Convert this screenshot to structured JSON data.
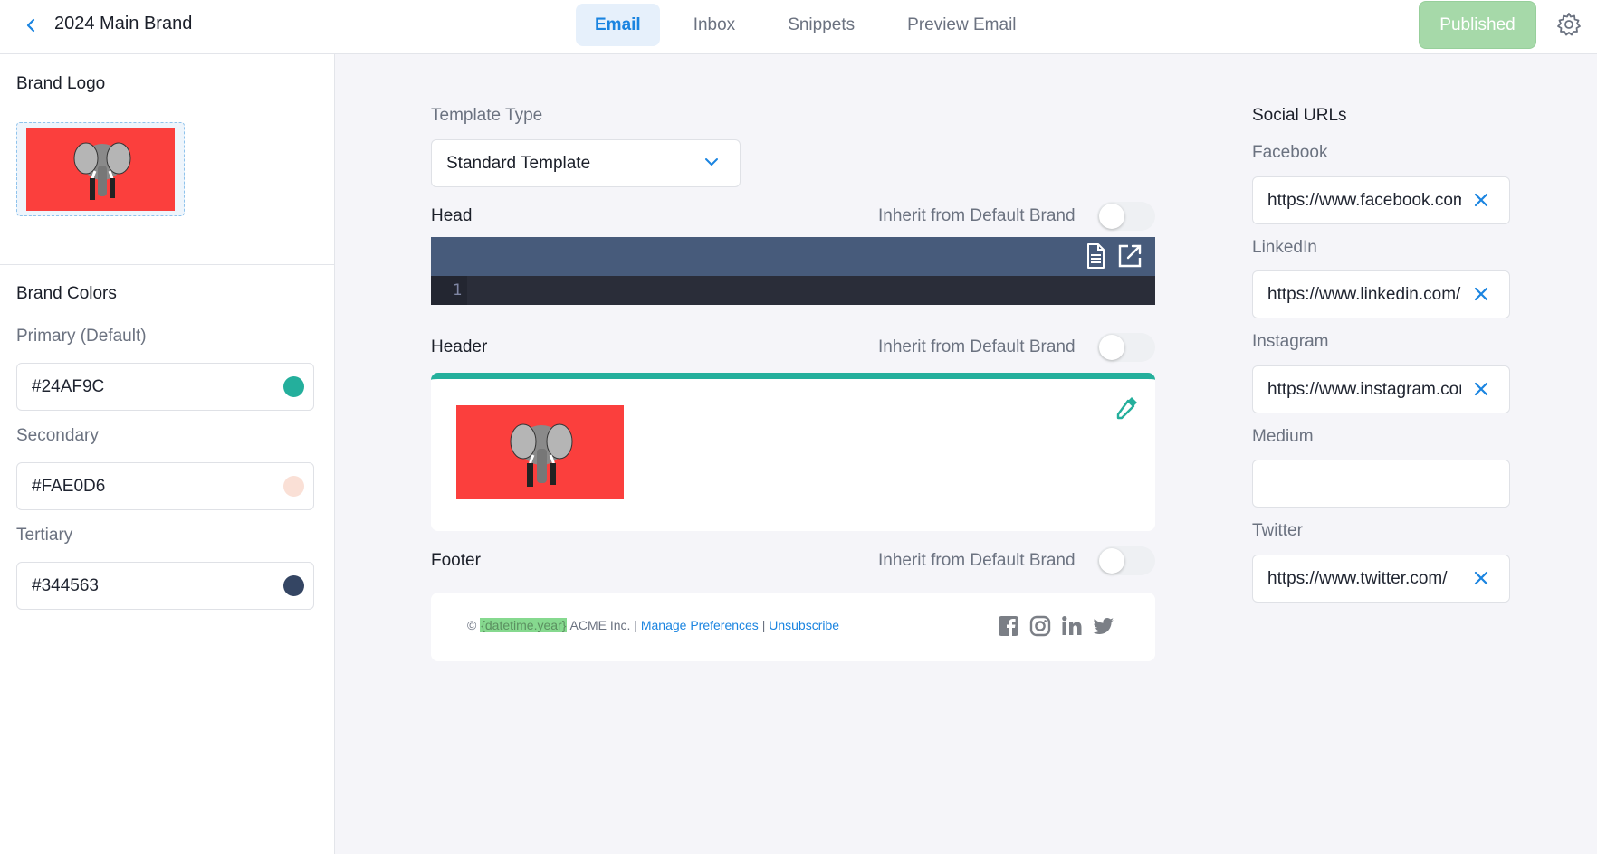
{
  "header": {
    "title": "2024 Main Brand",
    "tabs": [
      {
        "label": "Email",
        "active": true
      },
      {
        "label": "Inbox",
        "active": false
      },
      {
        "label": "Snippets",
        "active": false
      },
      {
        "label": "Preview Email",
        "active": false
      }
    ],
    "published_label": "Published",
    "icons": [
      "chevron-left-icon",
      "gear-icon"
    ]
  },
  "sidebar": {
    "logo_heading": "Brand Logo",
    "colors_heading": "Brand Colors",
    "colors": [
      {
        "label": "Primary (Default)",
        "value": "#24AF9C",
        "swatch": "#24AF9C"
      },
      {
        "label": "Secondary",
        "value": "#FAE0D6",
        "swatch": "#FAE0D6"
      },
      {
        "label": "Tertiary",
        "value": "#344563",
        "swatch": "#344563"
      }
    ]
  },
  "editor": {
    "template_type_label": "Template Type",
    "template_type_value": "Standard Template",
    "head_label": "Head",
    "header_label": "Header",
    "footer_label": "Footer",
    "inherit_label": "Inherit from Default Brand",
    "code_line_number": "1",
    "header_accent_color": "#24AF9C",
    "footer": {
      "copyright": "©",
      "year_var": "{datetime.year}",
      "company": "ACME Inc. |",
      "manage_link": "Manage Preferences",
      "separator": "|",
      "unsubscribe_link": "Unsubscribe"
    }
  },
  "social": {
    "heading": "Social URLs",
    "fields": [
      {
        "label": "Facebook",
        "value": "https://www.facebook.com/",
        "clearable": true
      },
      {
        "label": "LinkedIn",
        "value": "https://www.linkedin.com/",
        "clearable": true
      },
      {
        "label": "Instagram",
        "value": "https://www.instagram.com/",
        "clearable": true
      },
      {
        "label": "Medium",
        "value": "",
        "clearable": false
      },
      {
        "label": "Twitter",
        "value": "https://www.twitter.com/",
        "clearable": true
      }
    ]
  },
  "colors": {
    "accent_blue": "#1A84E0",
    "published_bg": "#A6D9A9",
    "logo_red": "#FB3F3D"
  }
}
